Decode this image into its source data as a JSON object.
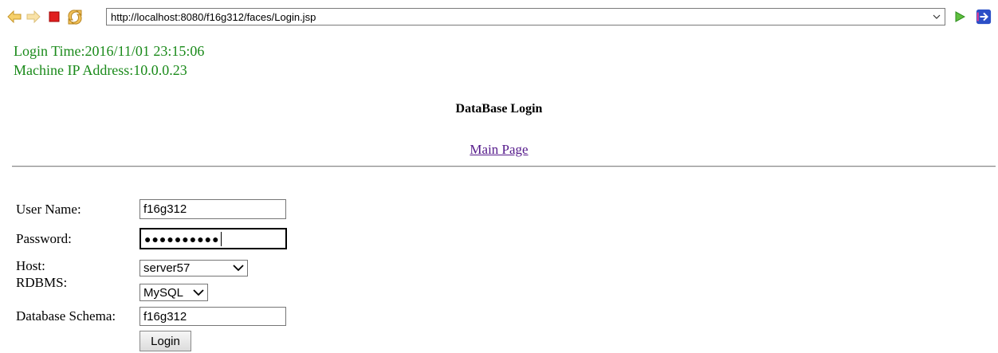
{
  "toolbar": {
    "back_icon": "back-arrow-icon",
    "forward_icon": "forward-arrow-icon",
    "stop_icon": "stop-icon",
    "refresh_icon": "refresh-icon",
    "url": "http://localhost:8080/f16g312/faces/Login.jsp",
    "go_icon": "go-play-icon",
    "extension_icon": "exit-icon"
  },
  "info": {
    "login_time": "Login Time:2016/11/01 23:15:06",
    "ip_address": "Machine IP Address:10.0.0.23"
  },
  "page": {
    "title": "DataBase Login",
    "main_link": "Main Page"
  },
  "form": {
    "user_name_label": "User Name:",
    "user_name_value": "f16g312",
    "password_label": "Password:",
    "password_masked": "●●●●●●●●●●",
    "host_label": "Host:",
    "host_value": "server57",
    "rdbms_label": "RDBMS:",
    "rdbms_value": "MySQL",
    "schema_label": "Database Schema:",
    "schema_value": "f16g312",
    "login_button": "Login"
  },
  "colors": {
    "info_text": "#1a8a1a",
    "link_visited": "#551a8b"
  }
}
